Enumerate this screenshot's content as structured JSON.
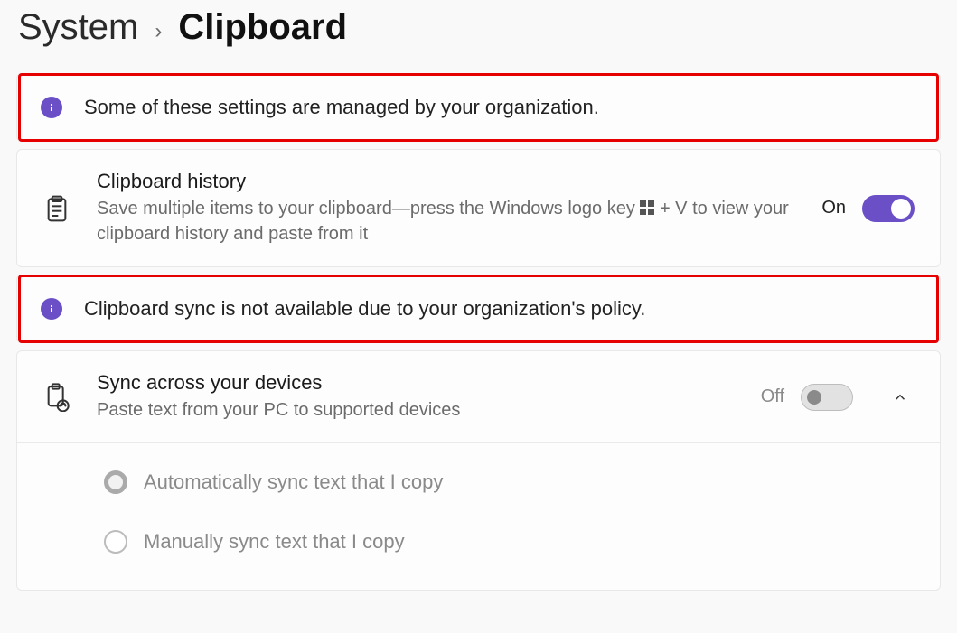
{
  "breadcrumb": {
    "parent": "System",
    "current": "Clipboard"
  },
  "banners": {
    "org_managed": "Some of these settings are managed by your organization.",
    "sync_blocked": "Clipboard sync is not available due to your organization's policy."
  },
  "settings": {
    "history": {
      "title": "Clipboard history",
      "desc_before": "Save multiple items to your clipboard—press the Windows logo key ",
      "desc_after": " + V to view your clipboard history and paste from it",
      "state_label": "On",
      "state": "on"
    },
    "sync": {
      "title": "Sync across your devices",
      "desc": "Paste text from your PC to supported devices",
      "state_label": "Off",
      "state": "off",
      "options": {
        "auto": "Automatically sync text that I copy",
        "manual": "Manually sync text that I copy"
      }
    }
  }
}
